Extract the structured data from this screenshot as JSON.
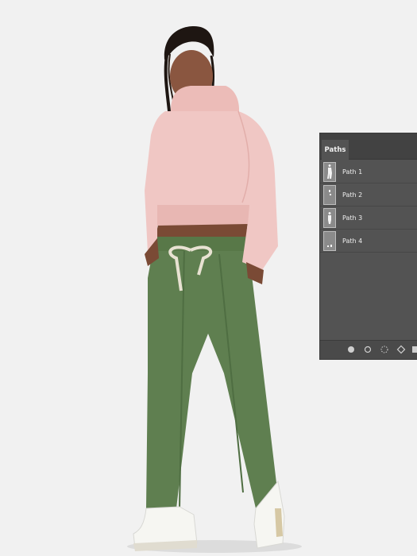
{
  "panel": {
    "tab_label": "Paths",
    "paths": [
      {
        "label": "Path 1",
        "thumb": "figure-silhouette-icon"
      },
      {
        "label": "Path 2",
        "thumb": "small-shape-icon"
      },
      {
        "label": "Path 3",
        "thumb": "figure-mask-icon"
      },
      {
        "label": "Path 4",
        "thumb": "shoes-shape-icon"
      }
    ],
    "footer_icons": [
      "fill-path-icon",
      "stroke-path-icon",
      "load-selection-icon",
      "make-path-icon"
    ]
  },
  "colors": {
    "background": "#f1f1f1",
    "hoodie": "#f0c7c4",
    "pants": "#5f7f50",
    "panel": "#535353"
  }
}
